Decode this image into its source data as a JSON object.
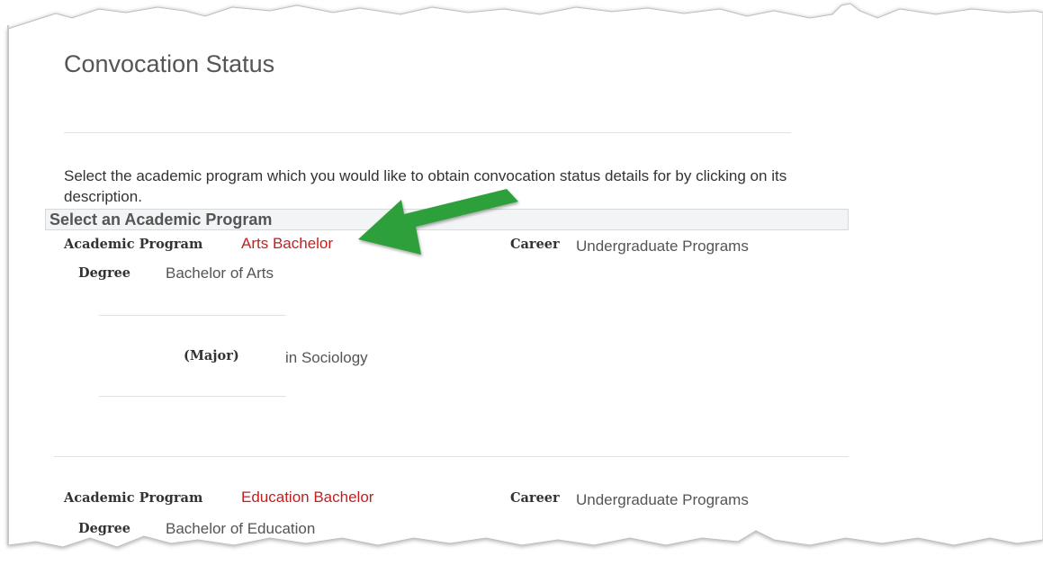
{
  "page": {
    "title": "Convocation Status",
    "instructions": "Select the academic program which you would like to obtain convocation status details for by clicking on its description."
  },
  "section": {
    "header": "Select an Academic Program"
  },
  "labels": {
    "academic_program": "Academic Program",
    "career": "Career",
    "degree": "Degree",
    "major": "(Major)"
  },
  "programs": [
    {
      "program": "Arts Bachelor",
      "career": "Undergraduate Programs",
      "degree": "Bachelor of Arts",
      "major": "in Sociology"
    },
    {
      "program": "Education Bachelor",
      "career": "Undergraduate Programs",
      "degree": "Bachelor of Education"
    }
  ],
  "colors": {
    "link": "#c41f1f",
    "arrow": "#2ea03a"
  },
  "annotation": {
    "icon": "green-arrow-icon"
  }
}
